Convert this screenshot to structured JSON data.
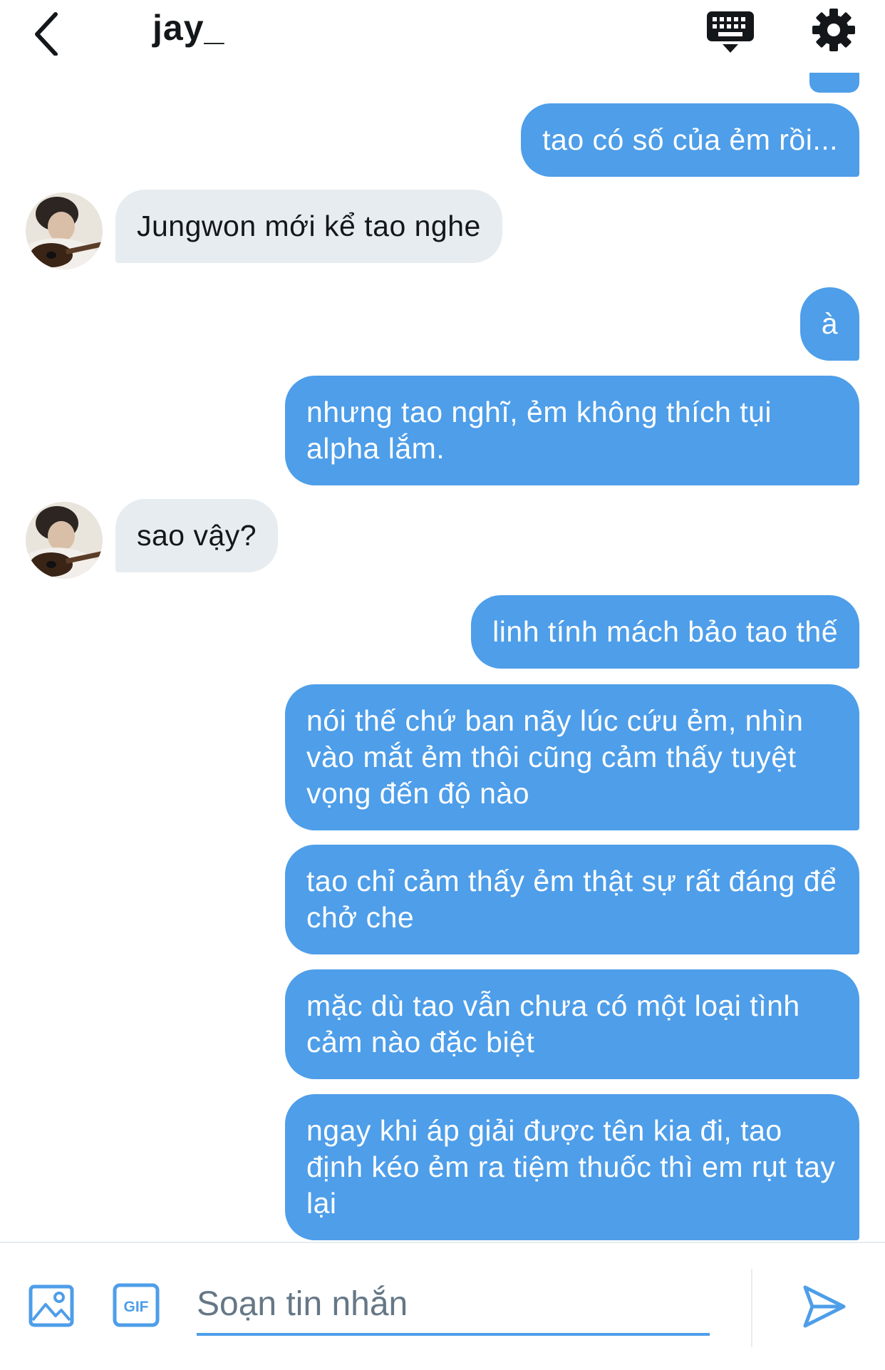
{
  "header": {
    "back_icon": "chevron-left-icon",
    "title": "jay_",
    "keyboard_icon": "keyboard-icon",
    "settings_icon": "gear-icon"
  },
  "messages": [
    {
      "from": "me",
      "text": "tao có số của ẻm rồi..."
    },
    {
      "from": "them",
      "text": "Jungwon mới kể tao nghe"
    },
    {
      "from": "me",
      "text": "à"
    },
    {
      "from": "me",
      "text": "nhưng tao nghĩ, ẻm không thích tụi alpha lắm."
    },
    {
      "from": "them",
      "text": "sao vậy?"
    },
    {
      "from": "me",
      "text": "linh tính mách bảo tao thế"
    },
    {
      "from": "me",
      "text": "nói thế chứ ban nãy lúc cứu ẻm, nhìn vào mắt ẻm thôi cũng cảm thấy tuyệt vọng đến độ nào"
    },
    {
      "from": "me",
      "text": "tao chỉ cảm thấy ẻm thật sự rất đáng để chở che"
    },
    {
      "from": "me",
      "text": "mặc dù tao vẫn chưa có một loại tình cảm nào đặc biệt"
    },
    {
      "from": "me",
      "text": "ngay khi áp giải được tên kia đi, tao định kéo ẻm ra tiệm thuốc thì em rụt tay lại"
    }
  ],
  "composer": {
    "image_icon": "image-icon",
    "gif_icon": "gif-icon",
    "gif_label": "GIF",
    "placeholder": "Soạn tin nhắn",
    "send_icon": "send-icon"
  },
  "colors": {
    "outgoing_bubble": "#4e9ee9",
    "incoming_bubble": "#e6ecf0",
    "accent": "#4e9ee9"
  }
}
